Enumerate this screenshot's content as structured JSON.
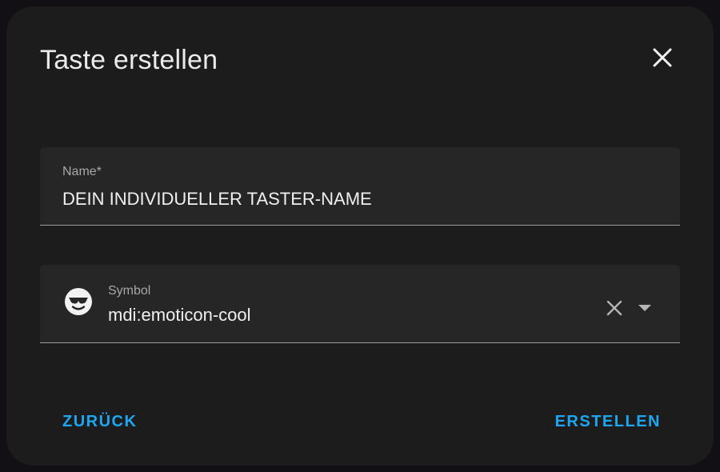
{
  "dialog": {
    "title": "Taste erstellen",
    "close_icon": "close-icon"
  },
  "name_field": {
    "label": "Name*",
    "value": "DEIN INDIVIDUELLER TASTER-NAME"
  },
  "symbol_field": {
    "label": "Symbol",
    "value": "mdi:emoticon-cool",
    "icon": "emoticon-cool-icon",
    "clear_icon": "clear-icon",
    "dropdown_icon": "dropdown-arrow-icon"
  },
  "actions": {
    "back_label": "ZURÜCK",
    "create_label": "ERSTELLEN"
  },
  "colors": {
    "accent": "#1ea7f0",
    "dialog_bg": "#1c1c1c",
    "field_bg": "#262626"
  }
}
